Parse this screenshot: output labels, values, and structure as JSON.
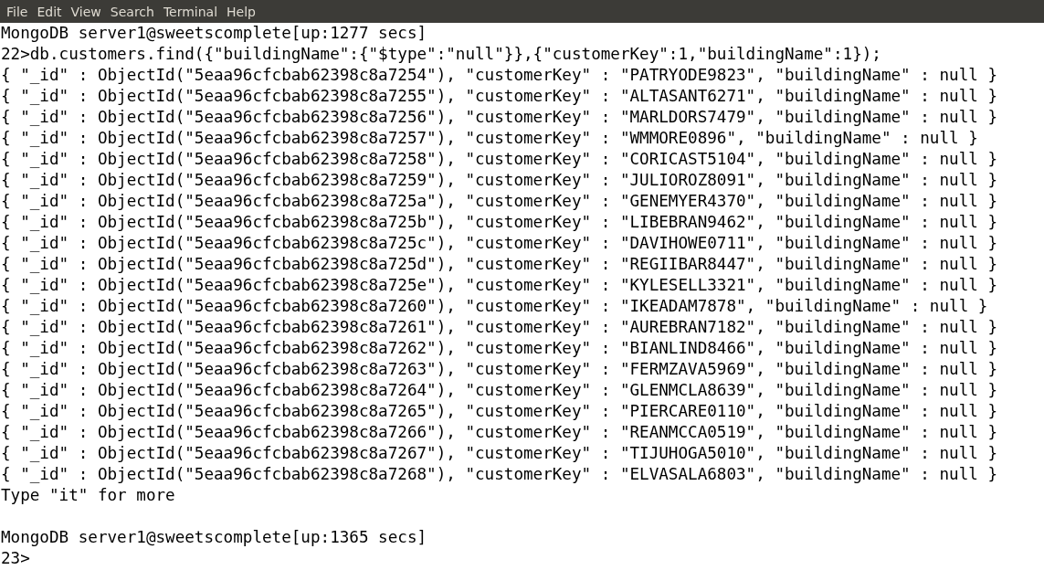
{
  "menu": [
    "File",
    "Edit",
    "View",
    "Search",
    "Terminal",
    "Help"
  ],
  "lines": [
    {
      "kind": "text",
      "text": "MongoDB server1@sweetscomplete[up:1277 secs]"
    },
    {
      "kind": "text",
      "text": "22>db.customers.find({\"buildingName\":{\"$type\":\"null\"}},{\"customerKey\":1,\"buildingName\":1});"
    },
    {
      "kind": "text",
      "text": "{ \"_id\" : ObjectId(\"5eaa96cfcbab62398c8a7254\"), \"customerKey\" : \"PATRYODE9823\", \"buildingName\" : null }"
    },
    {
      "kind": "text",
      "text": "{ \"_id\" : ObjectId(\"5eaa96cfcbab62398c8a7255\"), \"customerKey\" : \"ALTASANT6271\", \"buildingName\" : null }"
    },
    {
      "kind": "text",
      "text": "{ \"_id\" : ObjectId(\"5eaa96cfcbab62398c8a7256\"), \"customerKey\" : \"MARLDORS7479\", \"buildingName\" : null }"
    },
    {
      "kind": "text",
      "text": "{ \"_id\" : ObjectId(\"5eaa96cfcbab62398c8a7257\"), \"customerKey\" : \"WMMORE0896\", \"buildingName\" : null }"
    },
    {
      "kind": "text",
      "text": "{ \"_id\" : ObjectId(\"5eaa96cfcbab62398c8a7258\"), \"customerKey\" : \"CORICAST5104\", \"buildingName\" : null }"
    },
    {
      "kind": "text",
      "text": "{ \"_id\" : ObjectId(\"5eaa96cfcbab62398c8a7259\"), \"customerKey\" : \"JULIOROZ8091\", \"buildingName\" : null }"
    },
    {
      "kind": "text",
      "text": "{ \"_id\" : ObjectId(\"5eaa96cfcbab62398c8a725a\"), \"customerKey\" : \"GENEMYER4370\", \"buildingName\" : null }"
    },
    {
      "kind": "text",
      "text": "{ \"_id\" : ObjectId(\"5eaa96cfcbab62398c8a725b\"), \"customerKey\" : \"LIBEBRAN9462\", \"buildingName\" : null }"
    },
    {
      "kind": "text",
      "text": "{ \"_id\" : ObjectId(\"5eaa96cfcbab62398c8a725c\"), \"customerKey\" : \"DAVIHOWE0711\", \"buildingName\" : null }"
    },
    {
      "kind": "text",
      "text": "{ \"_id\" : ObjectId(\"5eaa96cfcbab62398c8a725d\"), \"customerKey\" : \"REGIIBAR8447\", \"buildingName\" : null }"
    },
    {
      "kind": "text",
      "text": "{ \"_id\" : ObjectId(\"5eaa96cfcbab62398c8a725e\"), \"customerKey\" : \"KYLESELL3321\", \"buildingName\" : null }"
    },
    {
      "kind": "text",
      "text": "{ \"_id\" : ObjectId(\"5eaa96cfcbab62398c8a7260\"), \"customerKey\" : \"IKEADAM7878\", \"buildingName\" : null }"
    },
    {
      "kind": "text",
      "text": "{ \"_id\" : ObjectId(\"5eaa96cfcbab62398c8a7261\"), \"customerKey\" : \"AUREBRAN7182\", \"buildingName\" : null }"
    },
    {
      "kind": "text",
      "text": "{ \"_id\" : ObjectId(\"5eaa96cfcbab62398c8a7262\"), \"customerKey\" : \"BIANLIND8466\", \"buildingName\" : null }"
    },
    {
      "kind": "text",
      "text": "{ \"_id\" : ObjectId(\"5eaa96cfcbab62398c8a7263\"), \"customerKey\" : \"FERMZAVA5969\", \"buildingName\" : null }"
    },
    {
      "kind": "text",
      "text": "{ \"_id\" : ObjectId(\"5eaa96cfcbab62398c8a7264\"), \"customerKey\" : \"GLENMCLA8639\", \"buildingName\" : null }"
    },
    {
      "kind": "text",
      "text": "{ \"_id\" : ObjectId(\"5eaa96cfcbab62398c8a7265\"), \"customerKey\" : \"PIERCARE0110\", \"buildingName\" : null }"
    },
    {
      "kind": "text",
      "text": "{ \"_id\" : ObjectId(\"5eaa96cfcbab62398c8a7266\"), \"customerKey\" : \"REANMCCA0519\", \"buildingName\" : null }"
    },
    {
      "kind": "text",
      "text": "{ \"_id\" : ObjectId(\"5eaa96cfcbab62398c8a7267\"), \"customerKey\" : \"TIJUHOGA5010\", \"buildingName\" : null }"
    },
    {
      "kind": "text",
      "text": "{ \"_id\" : ObjectId(\"5eaa96cfcbab62398c8a7268\"), \"customerKey\" : \"ELVASALA6803\", \"buildingName\" : null }"
    },
    {
      "kind": "text",
      "text": "Type \"it\" for more"
    },
    {
      "kind": "blank"
    },
    {
      "kind": "text",
      "text": "MongoDB server1@sweetscomplete[up:1365 secs]"
    },
    {
      "kind": "text",
      "text": "23>"
    }
  ]
}
